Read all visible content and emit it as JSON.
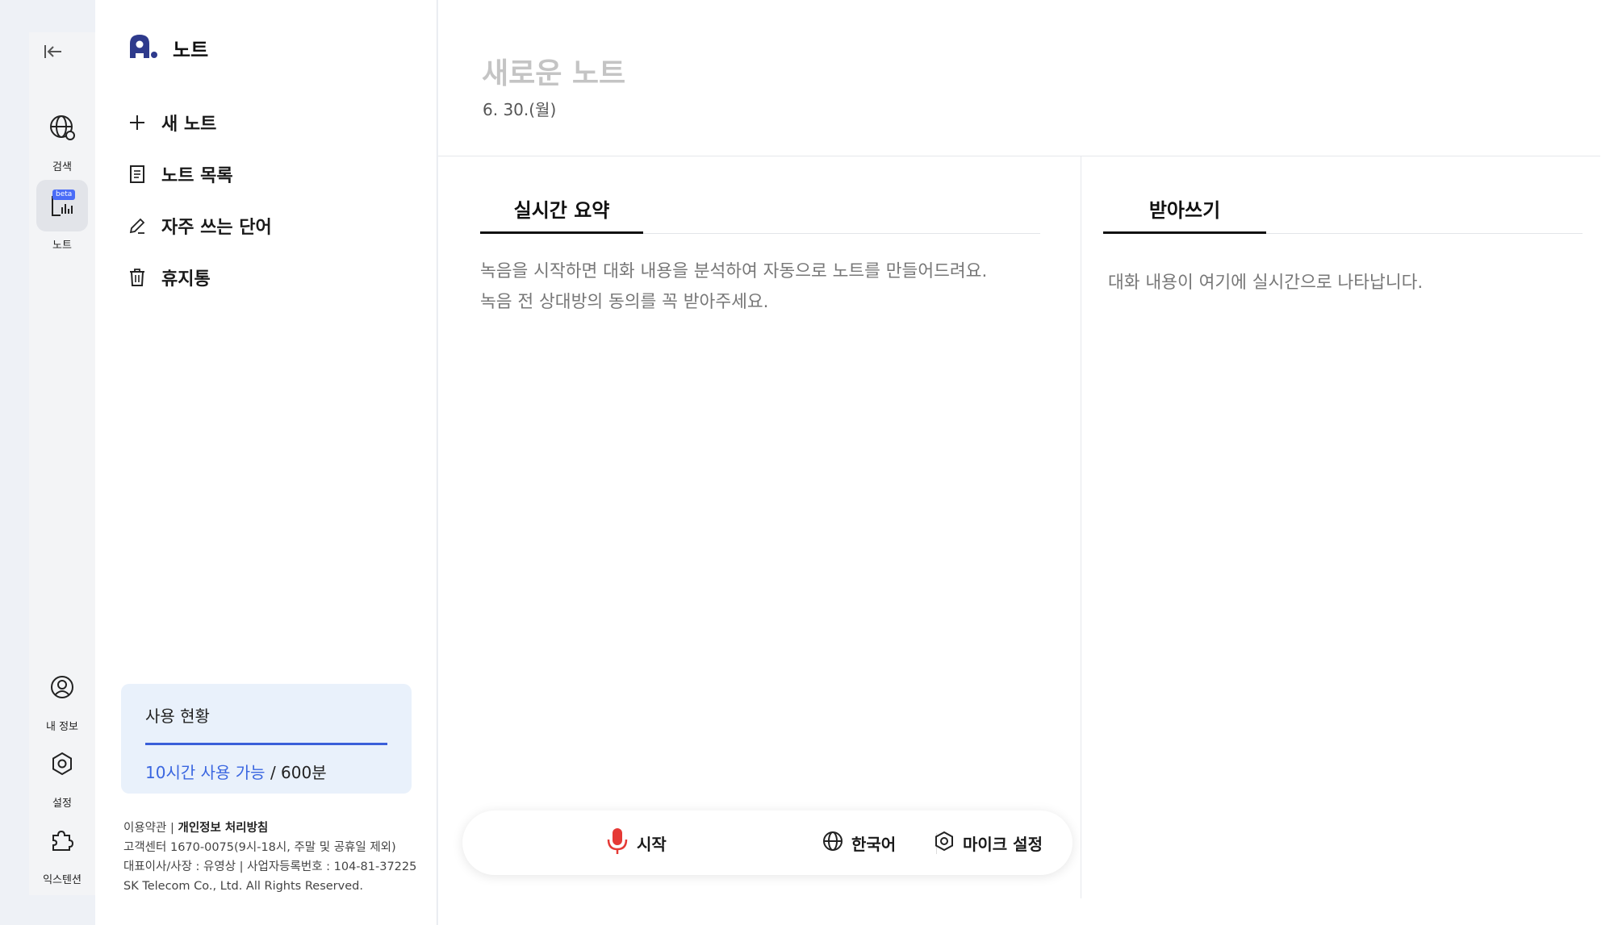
{
  "rail": {
    "items": [
      {
        "label": "검색",
        "icon": "globe-search-icon"
      },
      {
        "label": "노트",
        "icon": "note-audio-icon",
        "badge": "beta",
        "active": true
      },
      {
        "label": "내 정보",
        "icon": "user-icon"
      },
      {
        "label": "설정",
        "icon": "gear-icon"
      },
      {
        "label": "익스텐션",
        "icon": "extension-icon"
      }
    ]
  },
  "nav": {
    "brand_title": "노트",
    "items": [
      {
        "label": "새 노트",
        "icon": "plus-icon"
      },
      {
        "label": "노트 목록",
        "icon": "document-icon"
      },
      {
        "label": "자주 쓰는 단어",
        "icon": "pencil-icon"
      },
      {
        "label": "휴지통",
        "icon": "trash-icon"
      }
    ],
    "usage": {
      "title": "사용 현황",
      "available": "10시간 사용 가능",
      "total": "/ 600분",
      "fill_fraction": 1.0
    },
    "footer": {
      "terms": "이용약관",
      "separator": "|",
      "privacy": "개인정보 처리방침",
      "support": "고객센터 1670-0075(9시-18시, 주말 및 공휴일 제외)",
      "ceo": "대표이사/사장 : 유영상 | 사업자등록번호 : 104-81-37225",
      "copyright": "SK Telecom Co., Ltd. All Rights Reserved."
    }
  },
  "main": {
    "title": "새로운 노트",
    "date": "6. 30.(월)",
    "summary_tab": "실시간 요약",
    "summary_placeholder_1": "녹음을 시작하면 대화 내용을 분석하여 자동으로 노트를 만들어드려요.",
    "summary_placeholder_2": "녹음 전 상대방의 동의를 꼭 받아주세요.",
    "transcript_tab": "받아쓰기",
    "transcript_placeholder": "대화 내용이 여기에 실시간으로 나타납니다."
  },
  "controls": {
    "start": "시작",
    "language": "한국어",
    "mic_settings": "마이크 설정"
  },
  "colors": {
    "accent": "#3a66e0",
    "mic_red": "#e53935",
    "brand_navy": "#2e3a8c"
  }
}
